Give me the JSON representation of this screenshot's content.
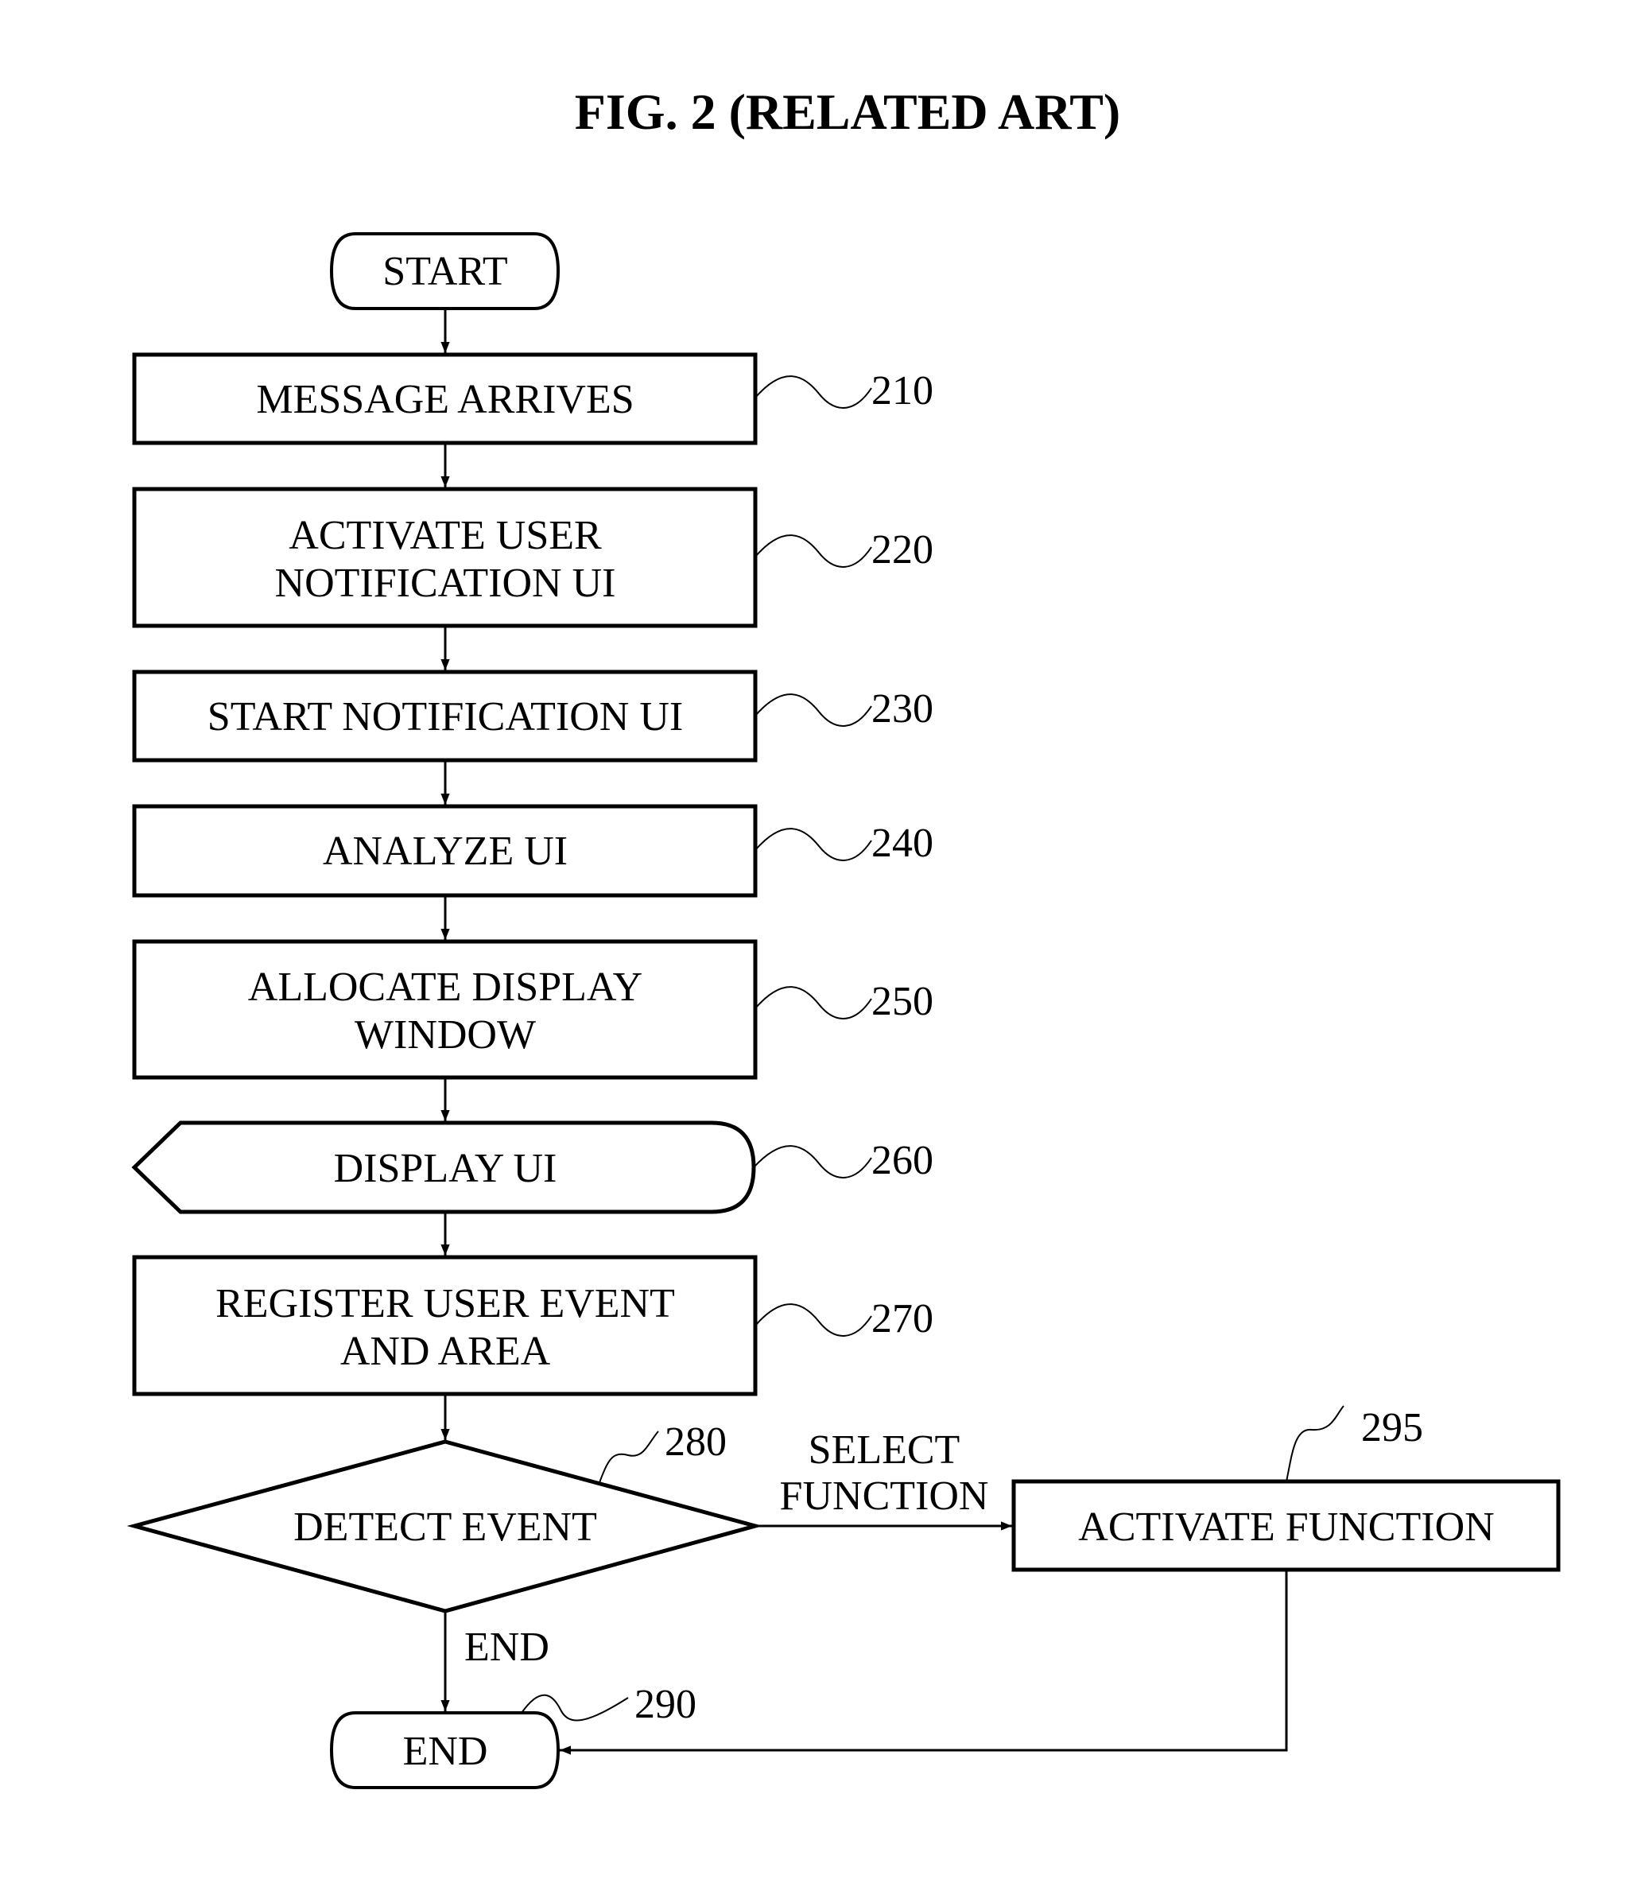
{
  "figure": {
    "title": "FIG. 2 (RELATED ART)"
  },
  "nodes": {
    "start": {
      "label": "START"
    },
    "n210": {
      "lines": [
        "MESSAGE ARRIVES"
      ],
      "ref": "210"
    },
    "n220": {
      "lines": [
        "ACTIVATE USER",
        "NOTIFICATION UI"
      ],
      "ref": "220"
    },
    "n230": {
      "lines": [
        "START NOTIFICATION UI"
      ],
      "ref": "230"
    },
    "n240": {
      "lines": [
        "ANALYZE UI"
      ],
      "ref": "240"
    },
    "n250": {
      "lines": [
        "ALLOCATE DISPLAY",
        "WINDOW"
      ],
      "ref": "250"
    },
    "n260": {
      "lines": [
        "DISPLAY UI"
      ],
      "ref": "260"
    },
    "n270": {
      "lines": [
        "REGISTER USER EVENT",
        "AND AREA"
      ],
      "ref": "270"
    },
    "n280": {
      "lines": [
        "DETECT EVENT"
      ],
      "ref": "280"
    },
    "n295": {
      "lines": [
        "ACTIVATE FUNCTION"
      ],
      "ref": "295"
    },
    "end": {
      "label": "END",
      "ref": "290"
    }
  },
  "edges": {
    "select_function": [
      "SELECT",
      "FUNCTION"
    ],
    "end_branch": "END"
  }
}
